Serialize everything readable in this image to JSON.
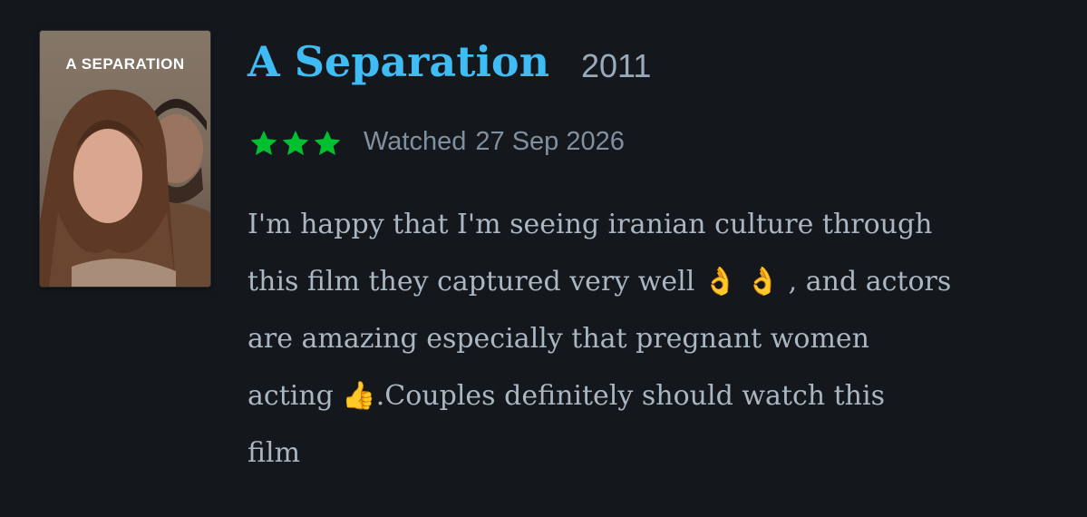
{
  "film": {
    "poster_title": "A SEPARATION",
    "title": "A Separation",
    "year": "2011"
  },
  "rating": {
    "stars": 3,
    "max_stars": 3,
    "star_color": "#00c030",
    "icon": "star-icon"
  },
  "watched": {
    "label": "Watched",
    "date": "27 Sep 2026"
  },
  "review": {
    "lines": [
      "I'm happy that I'm seeing iranian culture through",
      "this film they captured very well 👌 👌 , and actors",
      "are amazing especially that pregnant women",
      "acting 👍.Couples definitely should watch this",
      "film"
    ]
  },
  "colors": {
    "background": "#14181c",
    "title": "#40bcf4",
    "meta_text": "#8090a0",
    "review_text": "#aab6c2"
  }
}
